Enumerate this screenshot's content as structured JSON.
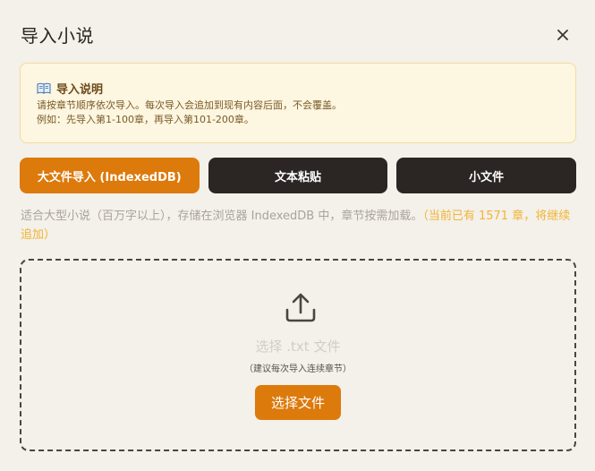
{
  "dialog": {
    "title": "导入小说"
  },
  "notice": {
    "icon": "book-icon",
    "title": "导入说明",
    "line1": "请按章节顺序依次导入。每次导入会追加到现有内容后面，不会覆盖。",
    "line2": "例如：先导入第1-100章，再导入第101-200章。"
  },
  "tabs": [
    {
      "label": "大文件导入 (IndexedDB)",
      "active": true
    },
    {
      "label": "文本粘贴",
      "active": false
    },
    {
      "label": "小文件",
      "active": false
    }
  ],
  "description": {
    "text": "适合大型小说（百万字以上），存储在浏览器 IndexedDB 中，章节按需加载。",
    "highlight": "（当前已有 1571 章，将继续追加）"
  },
  "dropzone": {
    "icon": "upload-icon",
    "label": "选择 .txt 文件",
    "hint": "（建议每次导入连续章节）",
    "button_label": "选择文件"
  },
  "colors": {
    "accent": "#dc7a0c",
    "dark_button": "#2b2623",
    "notice_bg": "#fdf6e0",
    "highlight_text": "#f0b535"
  }
}
